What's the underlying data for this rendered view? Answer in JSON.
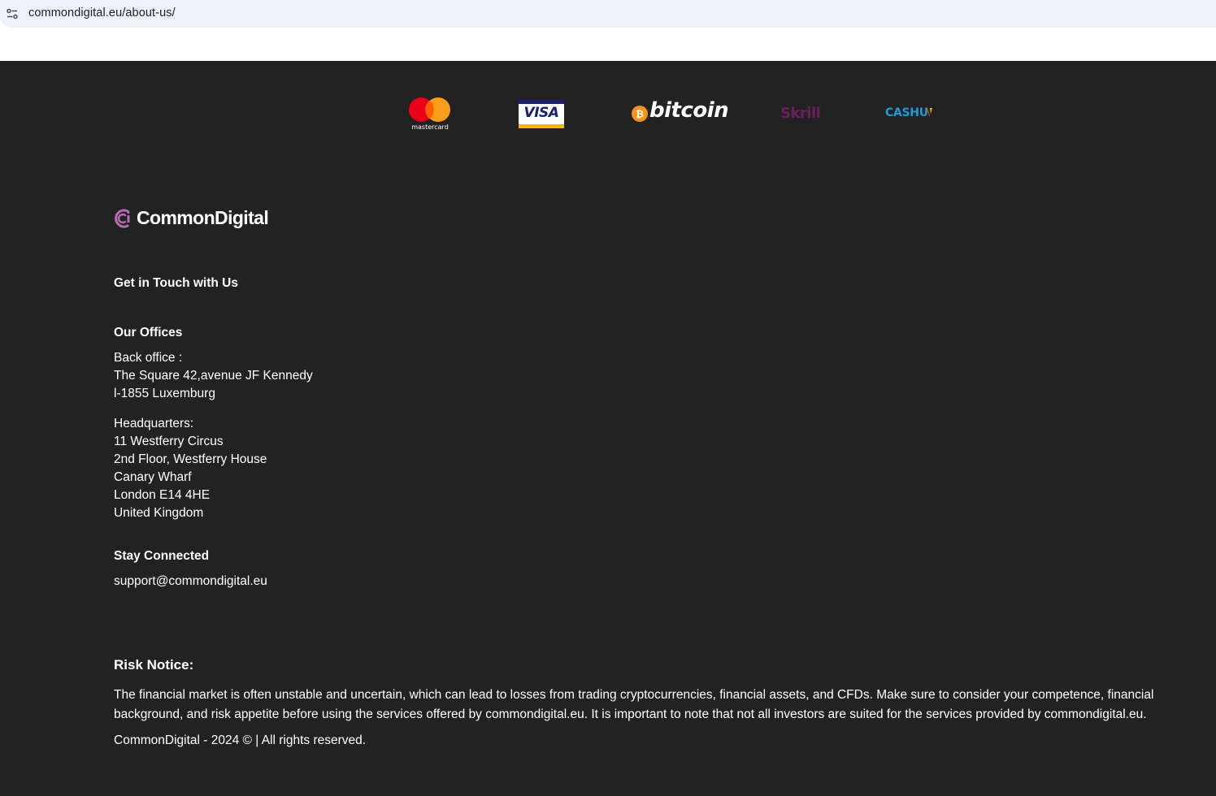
{
  "browser": {
    "url": "commondigital.eu/about-us/"
  },
  "payments": {
    "mastercard_label": "mastercard",
    "visa_label": "VISA",
    "bitcoin_label": "bitcoin",
    "skrill_label": "Skrill",
    "cashu_label": "CASHU"
  },
  "footer": {
    "brand_name": "CommonDigital",
    "get_in_touch": "Get in Touch with Us",
    "offices_heading": "Our Offices",
    "back_office": {
      "label": "Back office :",
      "line1": "The Square 42,avenue JF Kennedy",
      "line2": "l-1855 Luxemburg"
    },
    "headquarters": {
      "label": "Headquarters:",
      "line1": "11 Westferry Circus",
      "line2": "2nd Floor, Westferry House",
      "line3": "Canary Wharf",
      "line4": "London E14 4HE",
      "line5": "United Kingdom"
    },
    "stay_connected": "Stay Connected",
    "email": "support@commondigital.eu",
    "risk_heading": "Risk Notice:",
    "risk_text": "The financial market is often unstable and uncertain, which can lead to losses from trading cryptocurrencies, financial assets, and CFDs. Make sure to consider your competence, financial background, and risk appetite before using the services offered by commondigital.eu. It is important to note that not all investors are suited for the services provided by commondigital.eu.",
    "copyright": "CommonDigital - 2024 © | All rights reserved."
  },
  "colors": {
    "footer_bg": "#222222",
    "addressbar_bg": "#eef1f7",
    "brand_accent": "#b86bb0",
    "skrill": "#6b1e5e",
    "cashu": "#1f9ad6",
    "bitcoin": "#f7931a"
  },
  "icons": {
    "site_info": "tune-icon",
    "brand": "commondigital-logo-icon"
  }
}
